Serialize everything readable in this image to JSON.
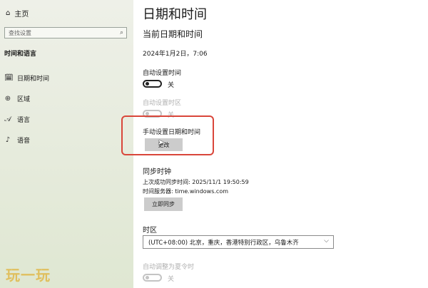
{
  "sidebar": {
    "home_label": "主页",
    "search_placeholder": "查找设置",
    "section_title": "时间和语言",
    "items": [
      {
        "label": "日期和时间",
        "icon": "calendar-clock-icon"
      },
      {
        "label": "区域",
        "icon": "globe-icon"
      },
      {
        "label": "语言",
        "icon": "language-icon"
      },
      {
        "label": "语音",
        "icon": "microphone-icon"
      }
    ]
  },
  "main": {
    "title": "日期和时间",
    "current_heading": "当前日期和时间",
    "current_value": "2024年1月2日，7:06",
    "auto_time": {
      "label": "自动设置时间",
      "state": "关"
    },
    "auto_timezone": {
      "label": "自动设置时区",
      "state": "关"
    },
    "manual": {
      "label": "手动设置日期和时间",
      "button": "更改"
    },
    "sync": {
      "heading": "同步时钟",
      "last_sync": "上次成功同步时间: 2025/11/1 19:50:59",
      "server": "时间服务器: time.windows.com",
      "button": "立即同步"
    },
    "timezone": {
      "heading": "时区",
      "value": "(UTC+08:00) 北京，重庆，香港特别行政区，乌鲁木齐"
    },
    "dst": {
      "label": "自动调整为夏令时",
      "state": "关"
    }
  },
  "watermark": "玩一玩",
  "colors": {
    "highlight": "#d9463a",
    "button_bg": "#cccccc"
  }
}
